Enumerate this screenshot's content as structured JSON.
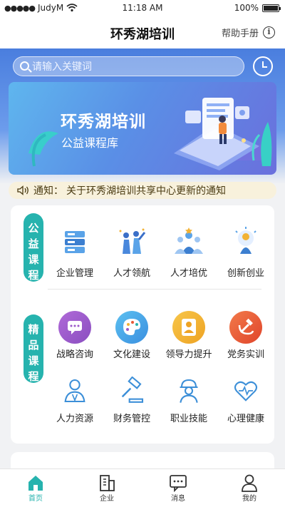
{
  "status_bar": {
    "carrier": "JudyM",
    "time": "11:18 AM",
    "battery": "100%",
    "battery_level": 1.0
  },
  "nav": {
    "title": "环秀湖培训",
    "help_label": "帮助手册"
  },
  "search": {
    "placeholder": "请输入关键词"
  },
  "banner": {
    "title": "环秀湖培训",
    "subtitle": "公益课程库"
  },
  "notice": {
    "label": "通知：",
    "text": "关于环秀湖培训共享中心更新的通知"
  },
  "sections": {
    "public": {
      "tag": "公益课程",
      "items": [
        {
          "label": "企业管理",
          "icon": "server-stack-icon"
        },
        {
          "label": "人才领航",
          "icon": "people-leading-icon"
        },
        {
          "label": "人才培优",
          "icon": "team-excellence-icon"
        },
        {
          "label": "创新创业",
          "icon": "lightbulb-person-icon"
        }
      ]
    },
    "premium": {
      "tag": "精品课程",
      "items": [
        {
          "label": "战略咨询",
          "icon": "chat-bubble-icon",
          "color": "#9b59c9"
        },
        {
          "label": "文化建设",
          "icon": "palette-icon",
          "color": "#4aa8e8"
        },
        {
          "label": "领导力提升",
          "icon": "person-badge-icon",
          "color": "#f2b234"
        },
        {
          "label": "党务实训",
          "icon": "hammer-sickle-icon",
          "color": "#e85a37"
        },
        {
          "label": "人力资源",
          "icon": "people-outline-icon"
        },
        {
          "label": "财务管控",
          "icon": "gavel-icon"
        },
        {
          "label": "职业技能",
          "icon": "worker-helmet-icon"
        },
        {
          "label": "心理健康",
          "icon": "heart-pulse-icon"
        }
      ]
    }
  },
  "tabbar": [
    {
      "label": "首页",
      "icon": "home-icon",
      "active": true
    },
    {
      "label": "企业",
      "icon": "building-icon",
      "active": false
    },
    {
      "label": "消息",
      "icon": "message-icon",
      "active": false
    },
    {
      "label": "我的",
      "icon": "user-icon",
      "active": false
    }
  ],
  "colors": {
    "accent": "#26b3ae",
    "hero_blue": "#4a7ede",
    "notice_bg": "#f8f1dc"
  }
}
